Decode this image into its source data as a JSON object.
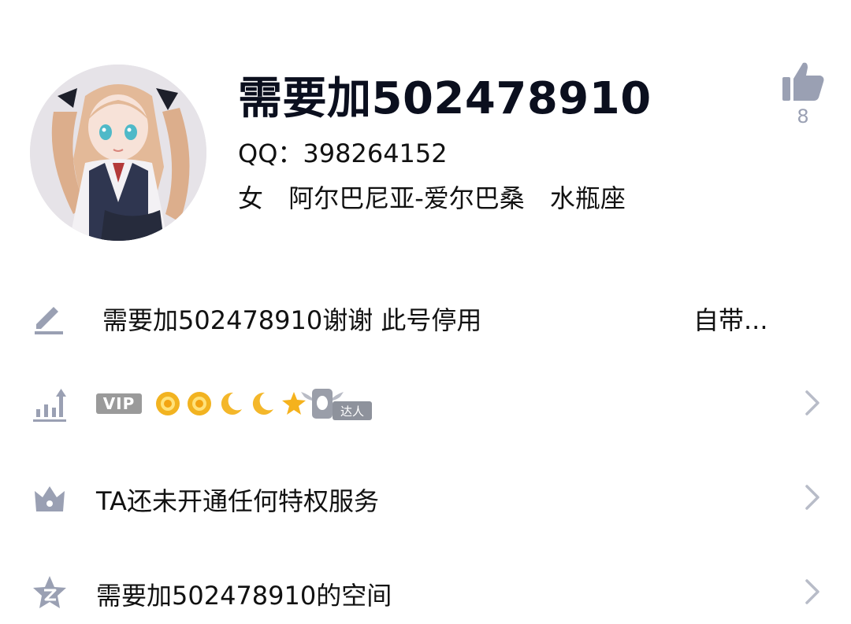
{
  "profile": {
    "nickname": "需要加502478910",
    "qq_label": "QQ：",
    "qq_number": "398264152",
    "gender": "女",
    "location": "阿尔巴尼亚-爱尔巴桑",
    "zodiac": "水瓶座",
    "like_count": "8"
  },
  "rows": {
    "signature": {
      "text": "需要加502478910谢谢 此号停用",
      "extra": "自带..."
    },
    "level": {
      "vip_label": "VIP",
      "level_icons": [
        "sun-icon",
        "sun-icon",
        "moon-icon",
        "moon-icon",
        "star-icon"
      ],
      "daren_label": "达人"
    },
    "privilege": {
      "text": "TA还未开通任何特权服务"
    },
    "qzone": {
      "text": "需要加502478910的空间"
    }
  },
  "colors": {
    "icon_gray": "#9aa0b3",
    "text": "#111111",
    "title": "#0b0f1e",
    "chevron": "#b8bcc8"
  }
}
